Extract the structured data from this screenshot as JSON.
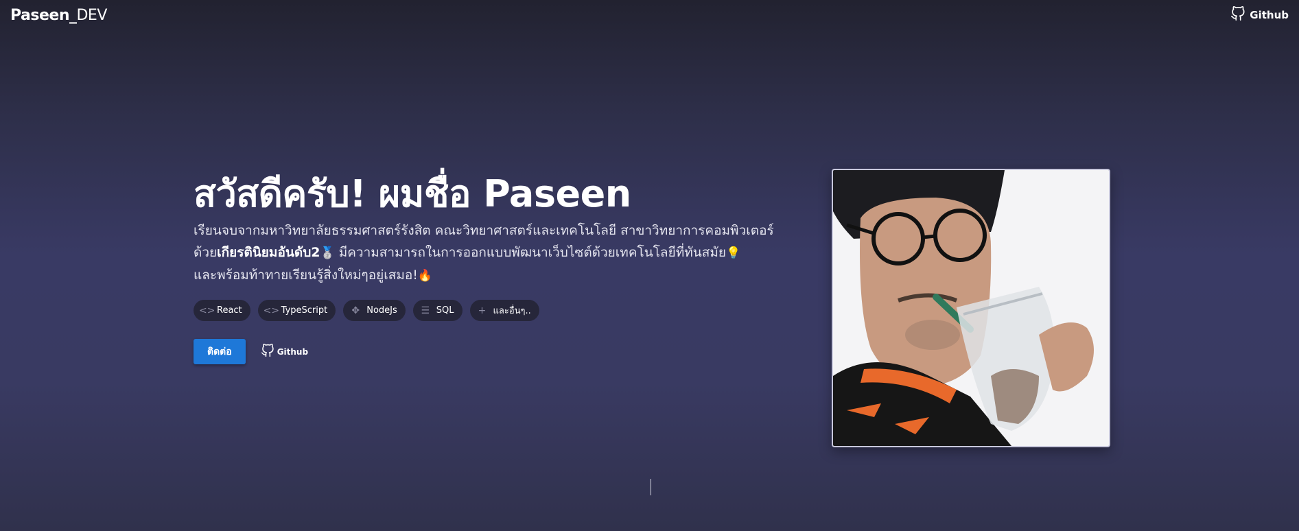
{
  "header": {
    "logo_bold": "Paseen_",
    "logo_thin": "DEV",
    "github_label": "Github",
    "github_icon": "github-icon"
  },
  "hero": {
    "title": "สวัสดีครับ! ผมชื่อ Paseen",
    "desc_line1": "เรียนจบจากมหาวิทยาลัยธรรมศาสตร์รังสิต คณะวิทยาศาสตร์และเทคโนโลยี สาขาวิทยาการคอมพิวเตอร์",
    "desc_line2_prefix": "ด้วย",
    "desc_line2_bold": "เกียรตินิยมอันดับ2",
    "desc_line2_emoji": "🥈",
    "desc_line2_rest": " มีความสามารถในการออกแบบพัฒนาเว็บไซต์ด้วยเทคโนโลยีที่ทันสมัย",
    "desc_line2_emoji2": "💡",
    "desc_line3": "และพร้อมท้าทายเรียนรู้สิ่งใหม่ๆอยู่เสมอ!",
    "desc_line3_emoji": "🔥"
  },
  "skills": [
    {
      "label": "React",
      "icon": "code-icon"
    },
    {
      "label": "TypeScript",
      "icon": "code-icon"
    },
    {
      "label": "NodeJs",
      "icon": "move-icon"
    },
    {
      "label": "SQL",
      "icon": "list-icon"
    },
    {
      "label": "และอื่นๆ..",
      "icon": "plus-icon"
    }
  ],
  "actions": {
    "contact_label": "ติดต่อ",
    "github_label": "Github",
    "github_icon": "github-icon"
  },
  "colors": {
    "accent": "#1e78d8",
    "chip_bg": "#26263a",
    "background_mid": "#393a64"
  }
}
